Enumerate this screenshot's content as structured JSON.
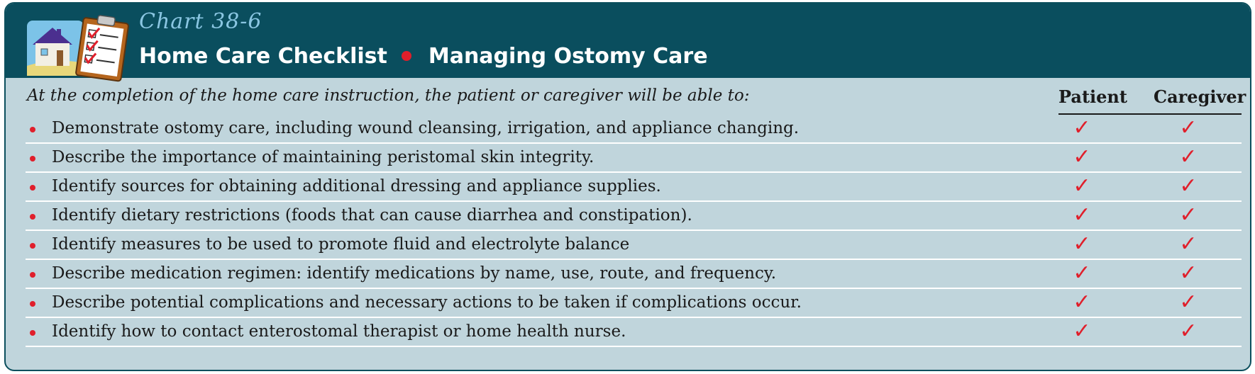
{
  "header": {
    "chart_number": "Chart 38-6",
    "title_left": "Home Care Checklist",
    "title_right": "Managing Ostomy Care"
  },
  "intro": "At the completion of the home care instruction, the patient or caregiver will be able to:",
  "columns": {
    "patient": "Patient",
    "caregiver": "Caregiver"
  },
  "check_glyph": "✓",
  "colors": {
    "header_bg": "#0a4e5e",
    "body_bg": "#c0d5dc",
    "accent_red": "#e01f2b",
    "chart_number": "#8ac6e2"
  },
  "items": [
    {
      "text": "Demonstrate ostomy care, including wound cleansing, irrigation, and appliance changing.",
      "patient": true,
      "caregiver": true
    },
    {
      "text": "Describe the importance of maintaining peristomal skin integrity.",
      "patient": true,
      "caregiver": true
    },
    {
      "text": "Identify sources for obtaining additional dressing and appliance supplies.",
      "patient": true,
      "caregiver": true
    },
    {
      "text": "Identify dietary restrictions (foods that can cause diarrhea and constipation).",
      "patient": true,
      "caregiver": true
    },
    {
      "text": "Identify measures to be used to promote fluid and electrolyte balance",
      "patient": true,
      "caregiver": true
    },
    {
      "text": "Describe medication regimen: identify medications by name, use, route, and frequency.",
      "patient": true,
      "caregiver": true
    },
    {
      "text": "Describe potential complications and necessary actions to be taken if complications occur.",
      "patient": true,
      "caregiver": true
    },
    {
      "text": "Identify how to contact enterostomal therapist or home health nurse.",
      "patient": true,
      "caregiver": true
    }
  ]
}
